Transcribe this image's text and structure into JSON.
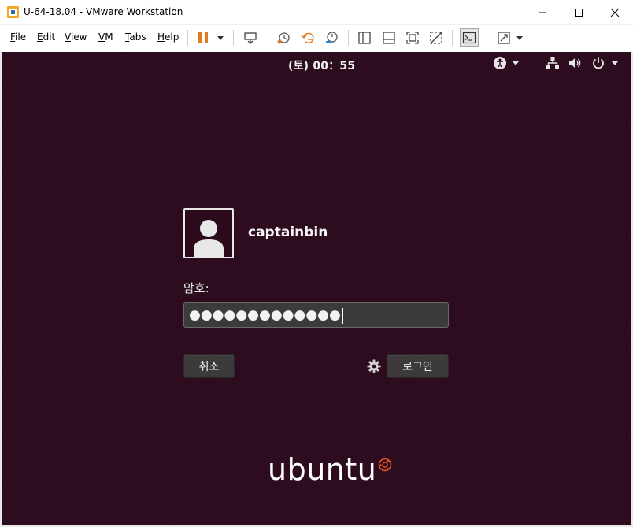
{
  "window": {
    "title": "U-64-18.04 - VMware Workstation"
  },
  "menu": {
    "items": [
      {
        "label": "File",
        "u": "F",
        "rest": "ile"
      },
      {
        "label": "Edit",
        "u": "E",
        "rest": "dit"
      },
      {
        "label": "View",
        "u": "V",
        "rest": "iew"
      },
      {
        "label": "VM",
        "u": "V",
        "rest": "M"
      },
      {
        "label": "Tabs",
        "u": "T",
        "rest": "abs"
      },
      {
        "label": "Help",
        "u": "H",
        "rest": "elp"
      }
    ]
  },
  "toolbar": {
    "icons": [
      "pause-icon",
      "send-ctrl-alt-del-icon",
      "snapshot-take-icon",
      "snapshot-revert-icon",
      "snapshot-manager-icon",
      "library-view-icon",
      "thumbnail-view-icon",
      "full-screen-icon",
      "unity-icon",
      "console-view-icon",
      "stretch-guest-icon"
    ]
  },
  "guest": {
    "clock": "(토) 00：55",
    "top_icons": [
      "accessibility-icon",
      "network-icon",
      "volume-icon",
      "power-icon"
    ],
    "login": {
      "username": "captainbin",
      "password_label": "암호:",
      "password_mask": "●●●●●●●●●●●●●",
      "cancel_label": "취소",
      "login_label": "로그인",
      "settings_icon": "gear-icon"
    },
    "logo_text": "ubuntu"
  },
  "colors": {
    "guest_background": "#2c0a1e",
    "pause_accent": "#e07a1e",
    "button_bg": "#3d3a3b",
    "field_bg": "#3b3b3b"
  }
}
